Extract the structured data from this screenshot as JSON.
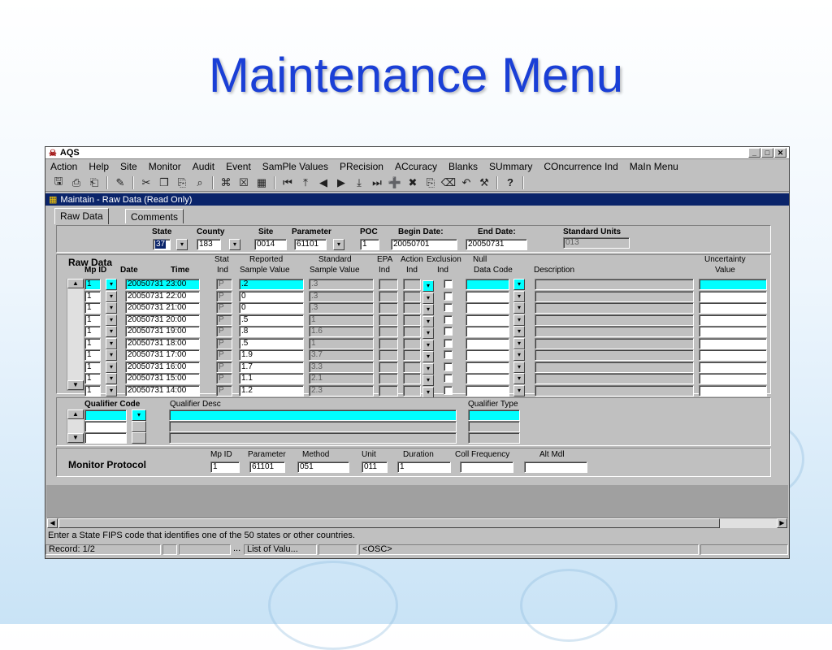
{
  "slide_title": "Maintenance Menu",
  "app": {
    "title": "AQS"
  },
  "menu": [
    "Action",
    "Help",
    "Site",
    "Monitor",
    "Audit",
    "Event",
    "SamPle Values",
    "PRecision",
    "ACcuracy",
    "Blanks",
    "SUmmary",
    "COncurrence Ind",
    "MaIn Menu"
  ],
  "toolbar_icons": [
    "save-icon",
    "print-icon",
    "exit-icon",
    "edit-icon",
    "cut-icon",
    "copy-icon",
    "paste-icon",
    "query-icon",
    "execute-query-icon",
    "cancel-query-icon",
    "list-icon",
    "first-record-icon",
    "previous-block-icon",
    "previous-record-icon",
    "next-record-icon",
    "next-block-icon",
    "last-record-icon",
    "insert-record-icon",
    "delete-record-icon",
    "duplicate-icon",
    "clear-icon",
    "undo-icon",
    "tools-icon",
    "help-icon"
  ],
  "child_window": {
    "title": "Maintain - Raw Data (Read Only)"
  },
  "tabs": [
    "Raw Data",
    "Comments"
  ],
  "header": {
    "labels": {
      "state": "State",
      "county": "County",
      "site": "Site",
      "parameter": "Parameter",
      "poc": "POC",
      "begin": "Begin Date:",
      "end": "End Date:",
      "units": "Standard Units"
    },
    "values": {
      "state": "37",
      "county": "183",
      "site": "0014",
      "parameter": "61101",
      "poc": "1",
      "begin": "20050701",
      "end": "20050731",
      "units": "013"
    }
  },
  "raw_data": {
    "title": "Raw Data",
    "columns": {
      "mp_id": "Mp ID",
      "date": "Date",
      "time": "Time",
      "stat": "Stat",
      "stat2": "Ind",
      "reported": "Reported",
      "reported2": "Sample Value",
      "standard": "Standard",
      "standard2": "Sample  Value",
      "epa": "EPA",
      "epa2": "Ind",
      "action": "Action",
      "action2": "Ind",
      "exclusion": "Exclusion",
      "exclusion2": "Ind",
      "null": "Null",
      "null2": "Data Code",
      "description": "Description",
      "uncertainty": "Uncertainty",
      "uncertainty2": "Value"
    },
    "rows": [
      {
        "mp": "1",
        "datetime": "20050731 23:00",
        "stat": "P",
        "reported": ".2",
        "standard": ".3"
      },
      {
        "mp": "1",
        "datetime": "20050731 22:00",
        "stat": "P",
        "reported": "0",
        "standard": ".3"
      },
      {
        "mp": "1",
        "datetime": "20050731 21:00",
        "stat": "P",
        "reported": "0",
        "standard": ".3"
      },
      {
        "mp": "1",
        "datetime": "20050731 20:00",
        "stat": "P",
        "reported": ".5",
        "standard": "1"
      },
      {
        "mp": "1",
        "datetime": "20050731 19:00",
        "stat": "P",
        "reported": ".8",
        "standard": "1.6"
      },
      {
        "mp": "1",
        "datetime": "20050731 18:00",
        "stat": "P",
        "reported": ".5",
        "standard": "1"
      },
      {
        "mp": "1",
        "datetime": "20050731 17:00",
        "stat": "P",
        "reported": "1.9",
        "standard": "3.7"
      },
      {
        "mp": "1",
        "datetime": "20050731 16:00",
        "stat": "P",
        "reported": "1.7",
        "standard": "3.3"
      },
      {
        "mp": "1",
        "datetime": "20050731 15:00",
        "stat": "P",
        "reported": "1.1",
        "standard": "2.1"
      },
      {
        "mp": "1",
        "datetime": "20050731 14:00",
        "stat": "P",
        "reported": "1.2",
        "standard": "2.3"
      }
    ]
  },
  "qualifier": {
    "code": "Qualifier Code",
    "desc": "Qualifier Desc",
    "type": "Qualifier Type"
  },
  "monitor_protocol": {
    "title": "Monitor Protocol",
    "labels": {
      "mp_id": "Mp ID",
      "parameter": "Parameter",
      "method": "Method",
      "unit": "Unit",
      "duration": "Duration",
      "coll_freq": "Coll Frequency",
      "alt_mdl": "Alt Mdl"
    },
    "values": {
      "mp_id": "1",
      "parameter": "61101",
      "method": "051",
      "unit": "011",
      "duration": "1",
      "coll_freq": "",
      "alt_mdl": ""
    }
  },
  "hint": "Enter a State FIPS code that identifies one of the 50 states or other countries.",
  "status": {
    "record": "Record: 1/2",
    "dots": "...",
    "lov": "List of Valu...",
    "osc": "<OSC>"
  },
  "colors": {
    "title_blue": "#1a3fd6",
    "active_title": "#0a246a",
    "current_row": "#00ffff"
  }
}
